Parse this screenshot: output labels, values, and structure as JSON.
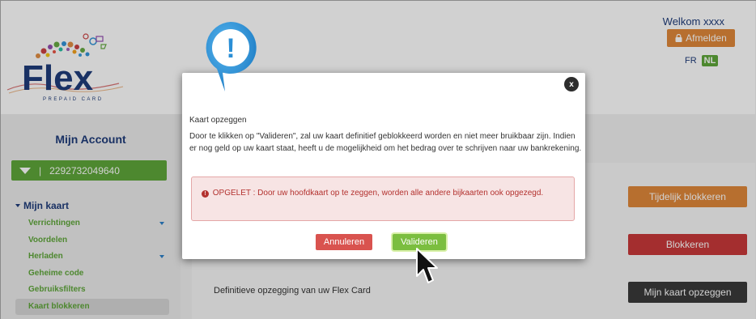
{
  "header": {
    "welcome_text": "Welkom xxxx",
    "logout_label": "Afmelden",
    "lang_fr": "FR",
    "lang_nl": "NL",
    "logo_text": "Flex",
    "logo_subtext": "PREPAID CARD"
  },
  "sidebar": {
    "title": "Mijn Account",
    "card_number": "2292732049640",
    "menu_heading": "Mijn kaart",
    "items": [
      {
        "label": "Verrichtingen",
        "has_submenu": true
      },
      {
        "label": "Voordelen",
        "has_submenu": false
      },
      {
        "label": "Herladen",
        "has_submenu": true
      },
      {
        "label": "Geheime code",
        "has_submenu": false
      },
      {
        "label": "Gebruiksfilters",
        "has_submenu": false
      },
      {
        "label": "Kaart blokkeren",
        "has_submenu": false,
        "active": true
      }
    ]
  },
  "content": {
    "temp_block_label": "Tijdelijk blokkeren",
    "block_label": "Blokkeren",
    "definitive_text": "Definitieve opzegging van uw Flex Card",
    "cancel_card_label": "Mijn kaart opzeggen"
  },
  "modal": {
    "close_label": "x",
    "title": "Kaart opzeggen",
    "body": "Door te klikken op \"Valideren\", zal uw kaart definitief geblokkeerd worden en niet meer bruikbaar zijn. Indien er nog geld op uw kaart staat, heeft u de mogelijkheid om het bedrag over te schrijven naar uw bankrekening.",
    "warning": "OPGELET : Door uw hoofdkaart op te zeggen, worden alle andere bijkaarten ook opgezegd.",
    "cancel_label": "Annuleren",
    "confirm_label": "Valideren",
    "alert_symbol": "!"
  },
  "colors": {
    "brand_blue": "#1f3c7a",
    "brand_green": "#5fa63a",
    "orange": "#e0883a",
    "red": "#c9393a",
    "dark": "#3a3a3a",
    "alert_blue": "#2a8fd6"
  }
}
